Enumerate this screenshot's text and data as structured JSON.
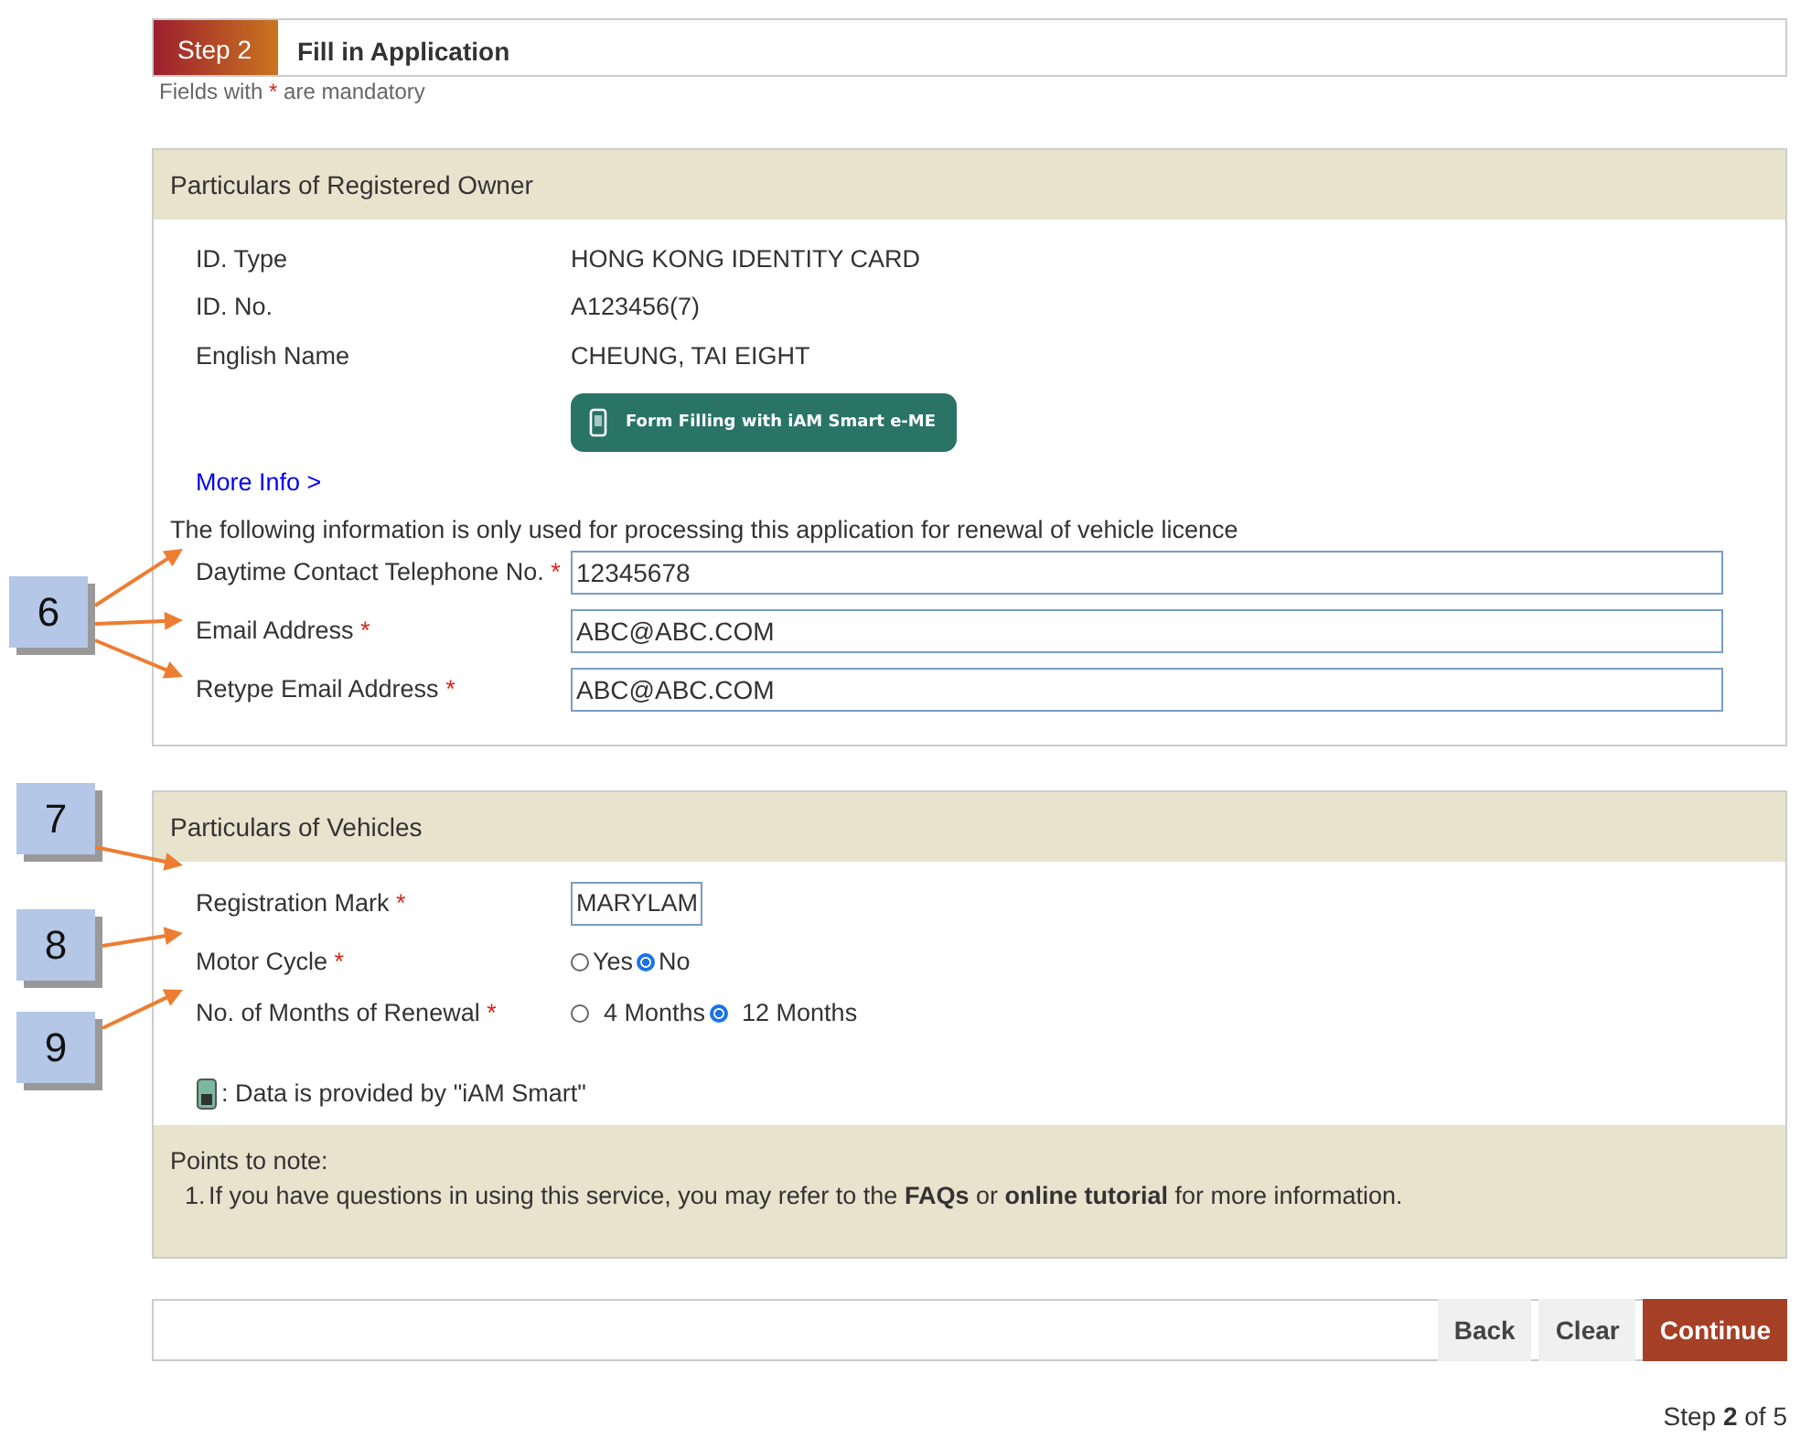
{
  "step": {
    "label": "Step 2",
    "title": "Fill in Application"
  },
  "mandatory_note": {
    "before": "Fields with",
    "mark": "*",
    "after": "are mandatory"
  },
  "owner": {
    "title": "Particulars of Registered Owner",
    "info": [
      {
        "label": "ID. Type",
        "value": "HONG KONG IDENTITY CARD"
      },
      {
        "label": "ID. No.",
        "value": "A123456(7)"
      },
      {
        "label": "English Name",
        "value": "CHEUNG, TAI EIGHT"
      }
    ],
    "iam_button": "Form Filling with iAM Smart e-ME",
    "more_info": "More Info >",
    "notice": "The following information is only used for processing this application for renewal of vehicle licence",
    "fields": [
      {
        "label": "Daytime Contact Telephone No.",
        "required": true,
        "value": "12345678"
      },
      {
        "label": "Email Address",
        "required": true,
        "value": "ABC@ABC.COM"
      },
      {
        "label": "Retype Email Address",
        "required": true,
        "value": "ABC@ABC.COM"
      }
    ]
  },
  "vehicles": {
    "title": "Particulars of Vehicles",
    "registration": {
      "label": "Registration Mark",
      "required": true,
      "value": "MARYLAM"
    },
    "radio_groups": [
      {
        "label": "Motor Cycle",
        "required": true,
        "options": [
          {
            "label": "Yes",
            "selected": false
          },
          {
            "label": "No",
            "selected": true
          }
        ]
      },
      {
        "label": "No. of Months of Renewal",
        "required": true,
        "options": [
          {
            "label": "4 Months",
            "selected": false
          },
          {
            "label": "12 Months",
            "selected": true
          }
        ]
      }
    ],
    "data_note": ": Data is provided by \"iAM Smart\""
  },
  "notes": {
    "title": "Points to note:",
    "items": [
      {
        "number": "1.",
        "text": "If you have questions in using this service, you may refer to the **FAQs** or **online tutorial** for more information."
      }
    ]
  },
  "buttons": [
    {
      "label": "Back",
      "kind": "secondary"
    },
    {
      "label": "Clear",
      "kind": "secondary"
    },
    {
      "label": "Continue",
      "kind": "primary"
    }
  ],
  "step_indicator": "Step **2** of 5",
  "callouts": [
    {
      "label": "6"
    },
    {
      "label": "7"
    },
    {
      "label": "8"
    },
    {
      "label": "9"
    }
  ]
}
